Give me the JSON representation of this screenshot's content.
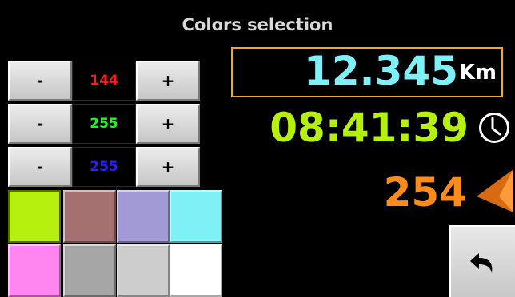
{
  "header": {
    "title": "Colors selection"
  },
  "rgb_controls": {
    "minus_label": "-",
    "plus_label": "+",
    "rows": [
      {
        "channel": "red",
        "value": "144",
        "color": "#ff1a1a"
      },
      {
        "channel": "green",
        "value": "255",
        "color": "#1aff1a"
      },
      {
        "channel": "blue",
        "value": "255",
        "color": "#2222ff"
      }
    ]
  },
  "palette": {
    "swatches": [
      {
        "color": "#b6f00f",
        "selected": true
      },
      {
        "color": "#a47070"
      },
      {
        "color": "#a29ad4"
      },
      {
        "color": "#7ff1f6"
      },
      {
        "color": "#ff86f0"
      },
      {
        "color": "#a6a6a6"
      },
      {
        "color": "#cdcdcd"
      },
      {
        "color": "#ffffff"
      }
    ]
  },
  "preview": {
    "distance": {
      "value": "12.345",
      "unit": "Km",
      "color": "#7df0f8",
      "border_color": "#f0a830"
    },
    "time": {
      "value": "08:41:39",
      "color": "#b6f00f",
      "icon": "clock-icon"
    },
    "heading": {
      "value": "254",
      "color": "#ff8c1a",
      "icon": "direction-arrow-icon"
    }
  },
  "back_button": {
    "icon": "back-arrow-icon"
  }
}
